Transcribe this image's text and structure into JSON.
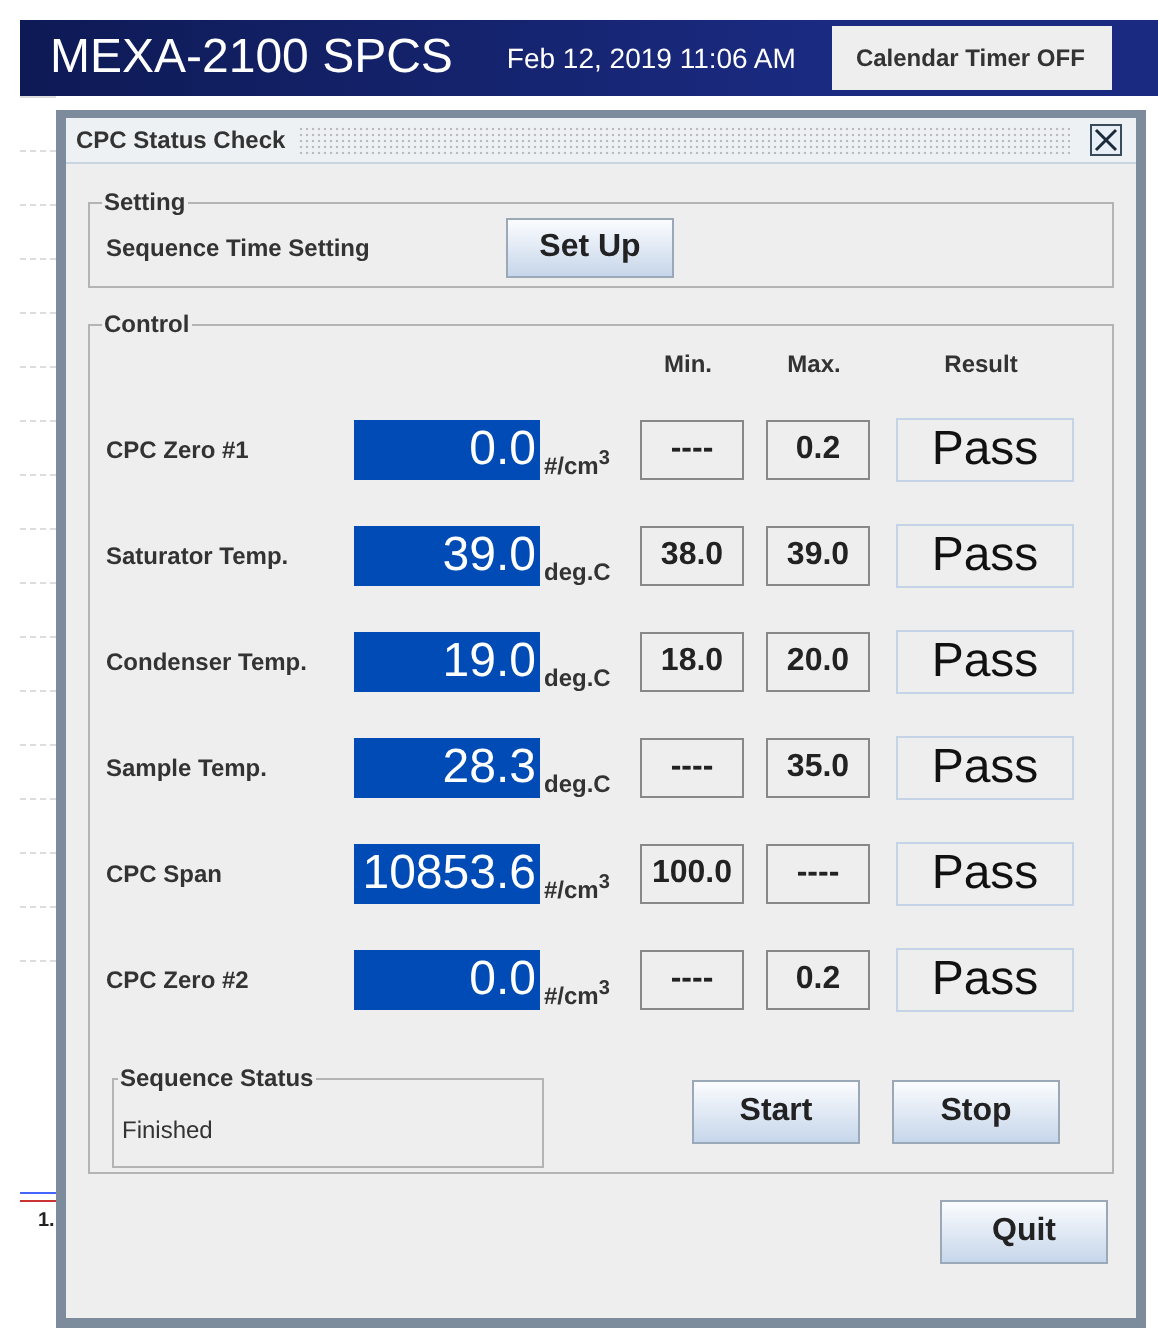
{
  "header": {
    "title": "MEXA-2100 SPCS",
    "datetime": "Feb 12, 2019 11:06 AM",
    "timer_button": "Calendar Timer OFF"
  },
  "background": {
    "label": "1."
  },
  "dialog": {
    "title": "CPC Status Check",
    "setting": {
      "legend": "Setting",
      "label": "Sequence Time Setting",
      "button": "Set Up"
    },
    "control": {
      "legend": "Control",
      "columns": [
        "Min.",
        "Max.",
        "Result"
      ],
      "rows": [
        {
          "name": "CPC Zero #1",
          "value": "0.0",
          "unit": "#/cm$^{3}$",
          "min": "----",
          "max": "0.2",
          "result": "Pass"
        },
        {
          "name": "Saturator Temp.",
          "value": "39.0",
          "unit": "deg.C",
          "min": "38.0",
          "max": "39.0",
          "result": "Pass"
        },
        {
          "name": "Condenser Temp.",
          "value": "19.0",
          "unit": "deg.C",
          "min": "18.0",
          "max": "20.0",
          "result": "Pass"
        },
        {
          "name": "Sample Temp.",
          "value": "28.3",
          "unit": "deg.C",
          "min": "----",
          "max": "35.0",
          "result": "Pass"
        },
        {
          "name": "CPC Span",
          "value": "10853.6",
          "unit": "#/cm$^{3}$",
          "min": "100.0",
          "max": "----",
          "result": "Pass"
        },
        {
          "name": "CPC Zero #2",
          "value": "0.0",
          "unit": "#/cm$^{3}$",
          "min": "----",
          "max": "0.2",
          "result": "Pass"
        }
      ],
      "sequence_status": {
        "legend": "Sequence Status",
        "value": "Finished"
      },
      "buttons": [
        "Start",
        "Stop"
      ]
    },
    "quit": "Quit"
  }
}
